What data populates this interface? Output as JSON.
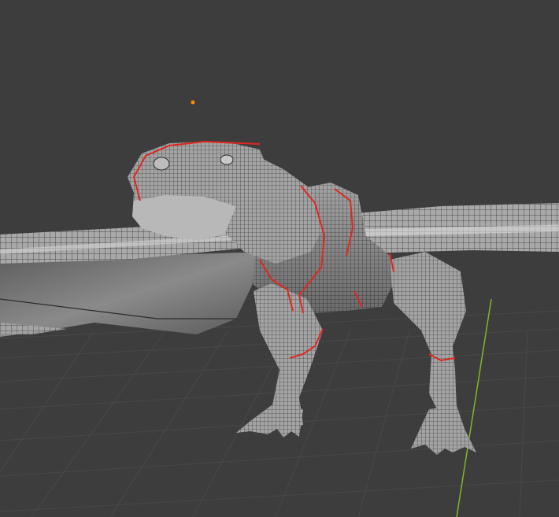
{
  "app": {
    "viewport": {
      "background_color": "#3d3d3d",
      "grid_color": "#484848",
      "y_axis_color": "#7fb827",
      "seam_color": "#e0271f",
      "mesh_color": "#9a9a9a",
      "origin_marker_color": "#ff8a00"
    },
    "scene": {
      "object": "dragon-mesh",
      "shading": "solid",
      "overlay": "wireframe",
      "seams_visible": true
    }
  }
}
